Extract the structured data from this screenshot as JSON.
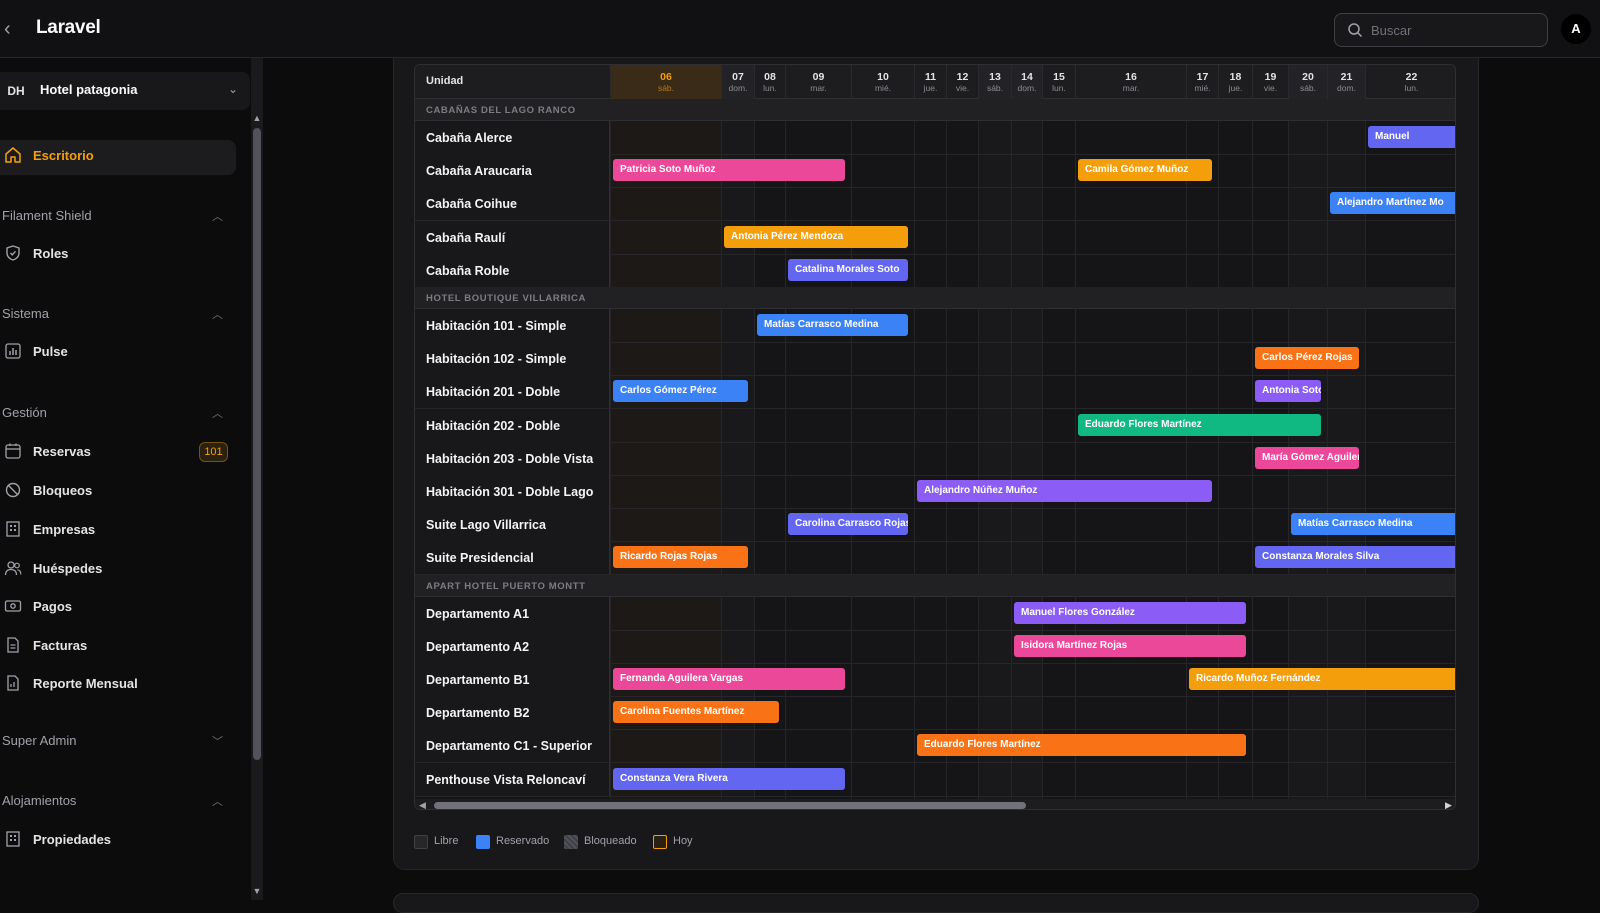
{
  "app": {
    "title": "Laravel"
  },
  "search": {
    "placeholder": "Buscar"
  },
  "user": {
    "initial": "A"
  },
  "tenant": {
    "badge": "DH",
    "name": "Hotel patagonia"
  },
  "sidebar": {
    "active": "Escritorio",
    "groups": [
      {
        "label": "Filament Shield",
        "items": [
          "Roles"
        ]
      },
      {
        "label": "Sistema",
        "items": [
          "Pulse"
        ]
      },
      {
        "label": "Gestión",
        "items": [
          "Reservas",
          "Bloqueos",
          "Empresas",
          "Huéspedes",
          "Pagos",
          "Facturas",
          "Reporte Mensual"
        ]
      },
      {
        "label": "Super Admin",
        "items": []
      },
      {
        "label": "Alojamientos",
        "items": [
          "Propiedades"
        ]
      }
    ],
    "reservas_badge": "101"
  },
  "calendar": {
    "unit_header": "Unidad",
    "days": [
      {
        "num": "06",
        "name": "sáb.",
        "today": true
      },
      {
        "num": "07",
        "name": "dom."
      },
      {
        "num": "08",
        "name": "lun."
      },
      {
        "num": "09",
        "name": "mar."
      },
      {
        "num": "10",
        "name": "mié."
      },
      {
        "num": "11",
        "name": "jue."
      },
      {
        "num": "12",
        "name": "vie."
      },
      {
        "num": "13",
        "name": "sáb."
      },
      {
        "num": "14",
        "name": "dom."
      },
      {
        "num": "15",
        "name": "lun."
      },
      {
        "num": "16",
        "name": "mar."
      },
      {
        "num": "17",
        "name": "mié."
      },
      {
        "num": "18",
        "name": "jue."
      },
      {
        "num": "19",
        "name": "vie."
      },
      {
        "num": "20",
        "name": "sáb."
      },
      {
        "num": "21",
        "name": "dom."
      },
      {
        "num": "22",
        "name": "lun."
      }
    ],
    "sections": [
      {
        "title": "CABAÑAS DEL LAGO RANCO",
        "units": [
          {
            "name": "Cabaña Alerce",
            "bookings": [
              {
                "guest": "Manuel",
                "color": "indigo",
                "start": "22",
                "end": "22",
                "cut": true
              }
            ]
          },
          {
            "name": "Cabaña Araucaria",
            "bookings": [
              {
                "guest": "Patricia Soto Muñoz",
                "color": "pink",
                "start": "06",
                "end": "09"
              },
              {
                "guest": "Camila Gómez Muñoz",
                "color": "amber",
                "start": "16",
                "end": "17"
              }
            ]
          },
          {
            "name": "Cabaña Coihue",
            "bookings": [
              {
                "guest": "Alejandro Martínez Mo",
                "color": "blue",
                "start": "21",
                "end": "22",
                "cut": true
              }
            ]
          },
          {
            "name": "Cabaña Raulí",
            "bookings": [
              {
                "guest": "Antonia Pérez Mendoza",
                "color": "amber",
                "start": "07",
                "end": "10"
              }
            ]
          },
          {
            "name": "Cabaña Roble",
            "bookings": [
              {
                "guest": "Catalina Morales Soto",
                "color": "indigo",
                "start": "09",
                "end": "10"
              }
            ]
          }
        ]
      },
      {
        "title": "HOTEL BOUTIQUE VILLARRICA",
        "units": [
          {
            "name": "Habitación 101 - Simple",
            "bookings": [
              {
                "guest": "Matías Carrasco Medina",
                "color": "blue",
                "start": "08",
                "end": "10"
              }
            ]
          },
          {
            "name": "Habitación 102 - Simple",
            "bookings": [
              {
                "guest": "Carlos Pérez Rojas",
                "color": "orange",
                "start": "19",
                "end": "21"
              }
            ]
          },
          {
            "name": "Habitación 201 - Doble",
            "bookings": [
              {
                "guest": "Carlos Gómez Pérez",
                "color": "blue",
                "start": "06",
                "end": "07"
              },
              {
                "guest": "Antonia Soto Gómez",
                "color": "violet",
                "start": "19",
                "end": "20"
              }
            ]
          },
          {
            "name": "Habitación 202 - Doble",
            "bookings": [
              {
                "guest": "Eduardo Flores Martínez",
                "color": "green",
                "start": "16",
                "end": "20"
              }
            ]
          },
          {
            "name": "Habitación 203 - Doble Vista",
            "bookings": [
              {
                "guest": "María Gómez Aguilera",
                "color": "pink",
                "start": "19",
                "end": "21"
              }
            ]
          },
          {
            "name": "Habitación 301 - Doble Lago",
            "bookings": [
              {
                "guest": "Alejandro Núñez Muñoz",
                "color": "violet",
                "start": "11",
                "end": "17"
              }
            ]
          },
          {
            "name": "Suite Lago Villarrica",
            "bookings": [
              {
                "guest": "Carolina Carrasco Rojas",
                "color": "indigo",
                "start": "09",
                "end": "10"
              },
              {
                "guest": "Matías Carrasco Medina",
                "color": "blue",
                "start": "20",
                "end": "22",
                "cut": true
              }
            ]
          },
          {
            "name": "Suite Presidencial",
            "bookings": [
              {
                "guest": "Ricardo Rojas Rojas",
                "color": "orange",
                "start": "06",
                "end": "07"
              },
              {
                "guest": "Constanza Morales Silva",
                "color": "indigo",
                "start": "19",
                "end": "22",
                "cut": true
              }
            ]
          }
        ]
      },
      {
        "title": "APART HOTEL PUERTO MONTT",
        "units": [
          {
            "name": "Departamento A1",
            "bookings": [
              {
                "guest": "Manuel Flores González",
                "color": "violet",
                "start": "14",
                "end": "18"
              }
            ]
          },
          {
            "name": "Departamento A2",
            "bookings": [
              {
                "guest": "Isidora Martínez Rojas",
                "color": "pink",
                "start": "14",
                "end": "18"
              }
            ]
          },
          {
            "name": "Departamento B1",
            "bookings": [
              {
                "guest": "Fernanda Aguilera Vargas",
                "color": "pink",
                "start": "06",
                "end": "09"
              },
              {
                "guest": "Ricardo Muñoz Fernández",
                "color": "amber",
                "start": "17",
                "end": "22",
                "cut": true
              }
            ]
          },
          {
            "name": "Departamento B2",
            "bookings": [
              {
                "guest": "Carolina Fuentes Martínez",
                "color": "orange",
                "start": "06",
                "end": "08"
              }
            ]
          },
          {
            "name": "Departamento C1 - Superior",
            "bookings": [
              {
                "guest": "Eduardo Flores Martínez",
                "color": "orange",
                "start": "11",
                "end": "18"
              }
            ]
          },
          {
            "name": "Penthouse Vista Reloncaví",
            "bookings": [
              {
                "guest": "Constanza Vera Rivera",
                "color": "indigo",
                "start": "06",
                "end": "09"
              }
            ]
          }
        ]
      }
    ]
  },
  "legend": [
    {
      "label": "Libre",
      "color": "#3f3f46"
    },
    {
      "label": "Reservado",
      "color": "#3b82f6"
    },
    {
      "label": "Bloqueado",
      "color": "#52525b"
    },
    {
      "label": "Hoy",
      "color": "#f59e0b"
    }
  ],
  "colors": {
    "accent": "#f59e0b",
    "background": "#0c0c0d",
    "card": "#18181b"
  }
}
